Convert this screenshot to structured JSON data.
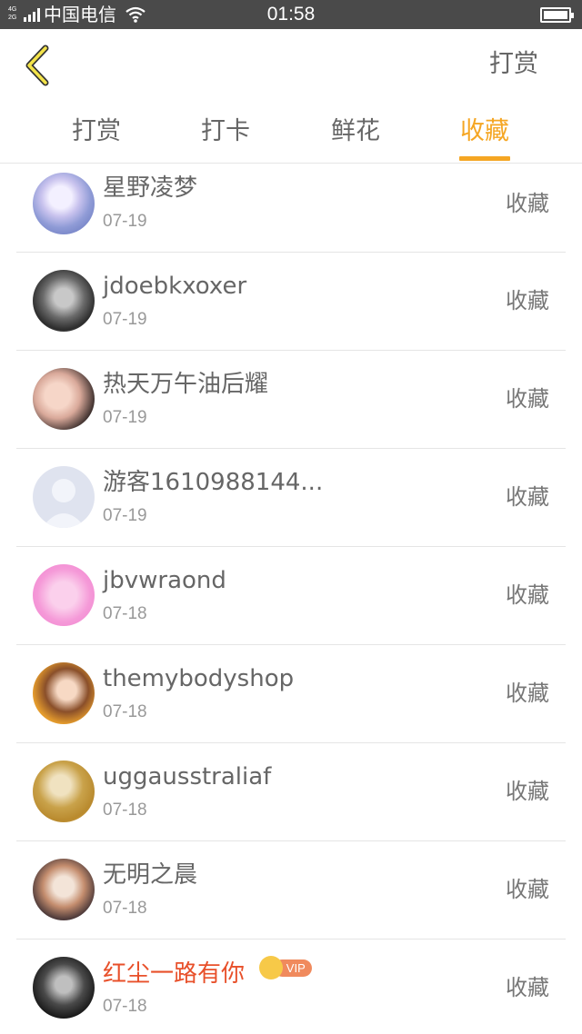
{
  "status_bar": {
    "network": "4G 2G",
    "carrier": "中国电信",
    "time": "01:58"
  },
  "header": {
    "right_label": "打赏",
    "back_icon": "chevron-left-icon"
  },
  "tabs": [
    {
      "label": "打赏",
      "active": false
    },
    {
      "label": "打卡",
      "active": false
    },
    {
      "label": "鲜花",
      "active": false
    },
    {
      "label": "收藏",
      "active": true
    }
  ],
  "colors": {
    "accent": "#f5a623",
    "vip_name": "#e8502a",
    "status_bar": "#4a4a4a"
  },
  "items": [
    {
      "name": "星野凌梦",
      "date": "07-19",
      "action": "收藏",
      "vip": false
    },
    {
      "name": "jdoebkxoxer",
      "date": "07-19",
      "action": "收藏",
      "vip": false
    },
    {
      "name": "热天万午油后耀",
      "date": "07-19",
      "action": "收藏",
      "vip": false
    },
    {
      "name": "游客1610988144...",
      "date": "07-19",
      "action": "收藏",
      "vip": false
    },
    {
      "name": "jbvwraond",
      "date": "07-18",
      "action": "收藏",
      "vip": false
    },
    {
      "name": "themybodyshop",
      "date": "07-18",
      "action": "收藏",
      "vip": false
    },
    {
      "name": "uggausstraliaf",
      "date": "07-18",
      "action": "收藏",
      "vip": false
    },
    {
      "name": "无明之晨",
      "date": "07-18",
      "action": "收藏",
      "vip": false
    },
    {
      "name": "红尘一路有你",
      "date": "07-18",
      "action": "收藏",
      "vip": true,
      "badge": "VIP"
    }
  ]
}
